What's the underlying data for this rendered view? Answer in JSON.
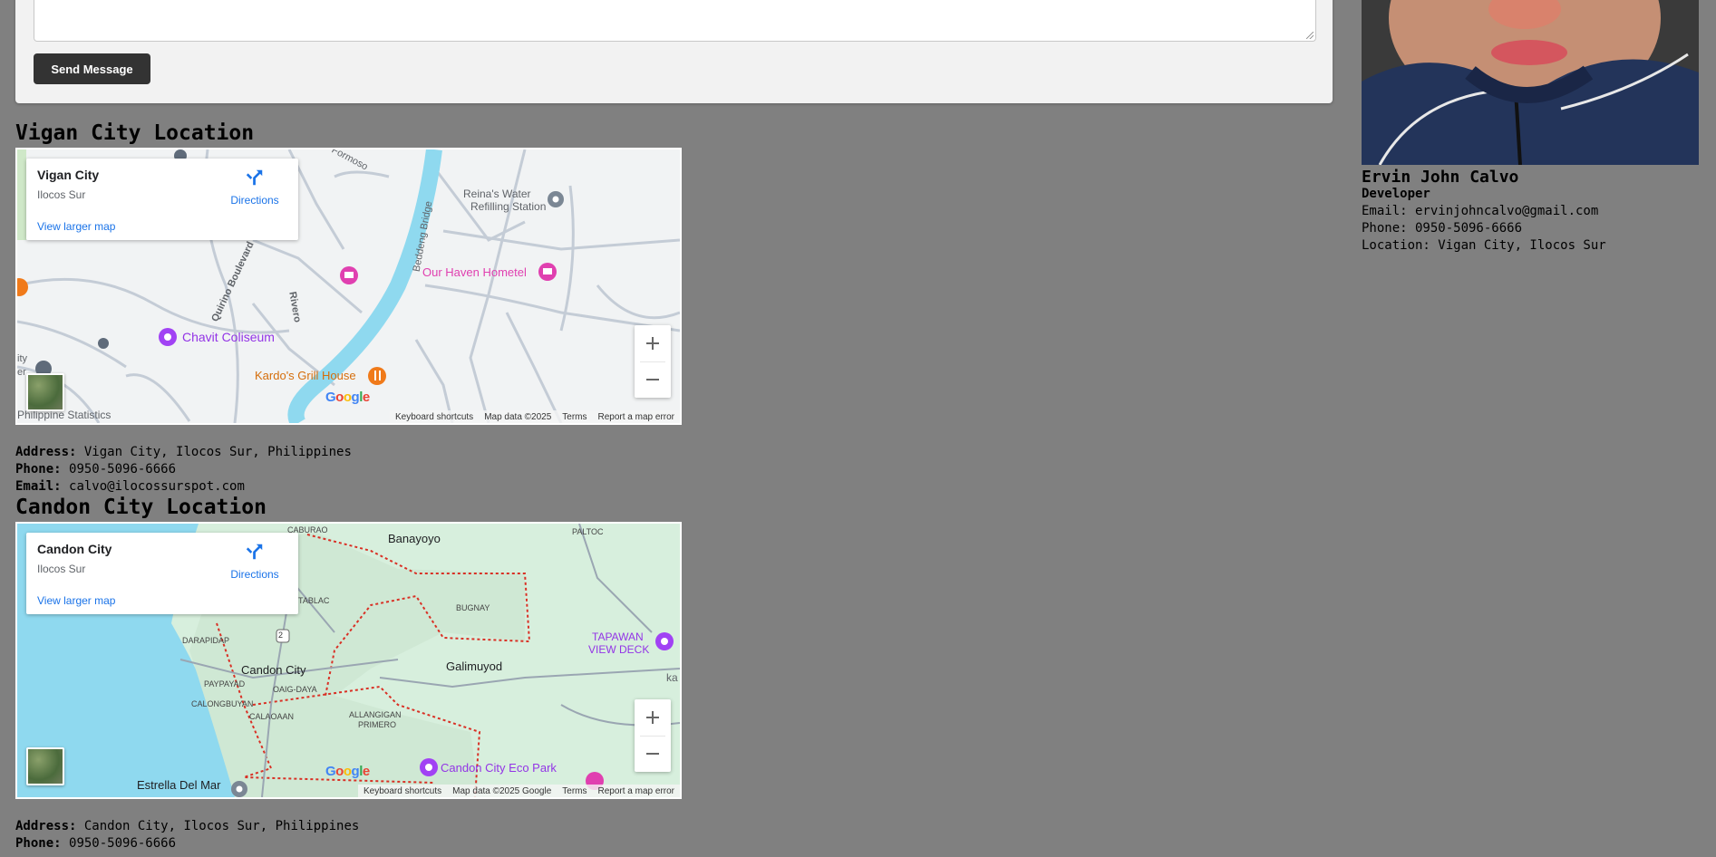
{
  "form": {
    "send_label": "Send Message"
  },
  "vigan": {
    "title": "Vigan City Location",
    "map": {
      "place_name": "Vigan City",
      "place_sub": "Ilocos Sur",
      "directions": "Directions",
      "larger_map": "View larger map",
      "labels": {
        "formoso": "Formoso",
        "reinas": "Reina's Water",
        "reinas2": "Refilling Station",
        "beddeng": "Beddeng Bridge",
        "haven": "Our Haven Hometel",
        "quirino": "Quirino Boulevard",
        "rivero": "Rivero",
        "chavit": "Chavit Coliseum",
        "kardos": "Kardo's Grill House",
        "psa": "Philippine Statistics",
        "ity": "ity",
        "er": "er"
      },
      "attribution": [
        "Keyboard shortcuts",
        "Map data ©2025",
        "Terms",
        "Report a map error"
      ]
    },
    "address_label": "Address:",
    "address": "Vigan City, Ilocos Sur, Philippines",
    "phone_label": "Phone:",
    "phone": "0950-5096-6666",
    "email_label": "Email:",
    "email": "calvo@ilocossurspot.com"
  },
  "candon": {
    "title": "Candon City Location",
    "map": {
      "place_name": "Candon City",
      "place_sub": "Ilocos Sur",
      "directions": "Directions",
      "larger_map": "View larger map",
      "labels": {
        "caburao": "CABURAO",
        "banayoyo": "Banayoyo",
        "paltoc": "PALTOC",
        "tablac": "TABLAC",
        "bugnay": "BUGNAY",
        "tapawan1": "TAPAWAN",
        "tapawan2": "VIEW DECK",
        "darapidap": "DARAPIDAP",
        "candon": "Candon City",
        "galimuyod": "Galimuyod",
        "paypayad": "PAYPAYAD",
        "oaigdaya": "OAIG-DAYA",
        "calongbuyan": "CALONGBUYAN",
        "calaoaan": "CALAOAAN",
        "allangigan1": "ALLANGIGAN",
        "allangigan2": "PRIMERO",
        "ecopark": "Candon City Eco Park",
        "estrella": "Estrella Del Mar",
        "road2": "2",
        "ka": "ka"
      },
      "attribution": [
        "Keyboard shortcuts",
        "Map data ©2025 Google",
        "Terms",
        "Report a map error"
      ]
    },
    "address_label": "Address:",
    "address": "Candon City, Ilocos Sur, Philippines",
    "phone_label": "Phone:",
    "phone": "0950-5096-6666"
  },
  "profile": {
    "name": "Ervin John Calvo",
    "role": "Developer",
    "email": "Email: ervinjohncalvo@gmail.com",
    "phone": "Phone: 0950-5096-6666",
    "location": "Location: Vigan City, Ilocos Sur"
  },
  "colors": {
    "page_bg": "#808080",
    "button_bg": "#333333",
    "link": "#1a73e8",
    "river": "#8fd9ef",
    "poi_pink": "#e040b0",
    "poi_purple": "#9334e6",
    "poi_orange": "#f07a1a"
  }
}
